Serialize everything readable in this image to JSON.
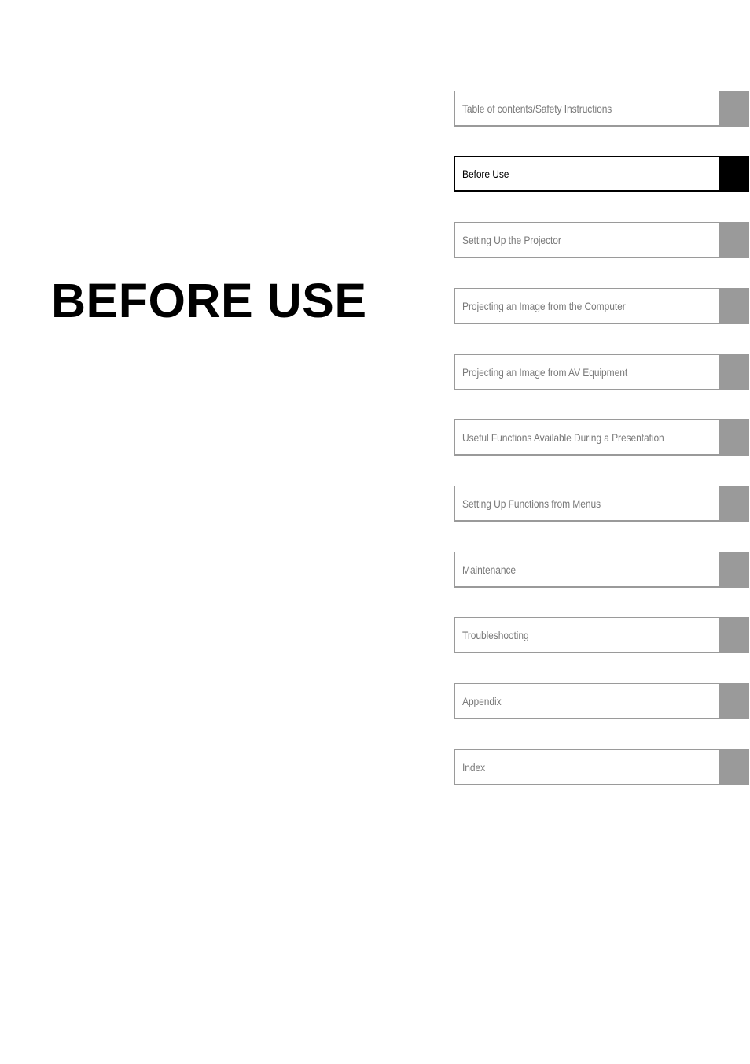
{
  "page": {
    "chapter_title": "BEFORE USE"
  },
  "colors": {
    "inactive_tab": "#9a9a9a",
    "active_tab": "#000000",
    "inactive_text": "#7a7a7a",
    "active_text": "#000000"
  },
  "tabs": [
    {
      "label": "Table of contents/Safety Instructions",
      "active": false
    },
    {
      "label": "Before Use",
      "active": true
    },
    {
      "label": "Setting Up the Projector",
      "active": false
    },
    {
      "label": "Projecting an Image from the Computer",
      "active": false
    },
    {
      "label": "Projecting an Image from AV Equipment",
      "active": false
    },
    {
      "label": "Useful Functions Available During a Presentation",
      "active": false
    },
    {
      "label": "Setting Up Functions from Menus",
      "active": false
    },
    {
      "label": "Maintenance",
      "active": false
    },
    {
      "label": "Troubleshooting",
      "active": false
    },
    {
      "label": "Appendix",
      "active": false
    },
    {
      "label": "Index",
      "active": false
    }
  ]
}
